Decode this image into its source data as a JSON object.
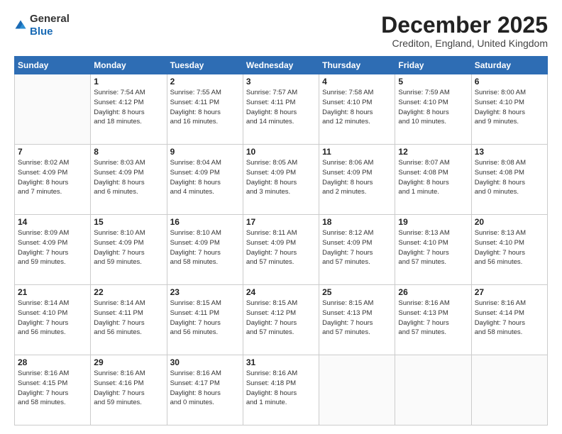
{
  "logo": {
    "general": "General",
    "blue": "Blue"
  },
  "title": "December 2025",
  "location": "Crediton, England, United Kingdom",
  "weekdays": [
    "Sunday",
    "Monday",
    "Tuesday",
    "Wednesday",
    "Thursday",
    "Friday",
    "Saturday"
  ],
  "weeks": [
    [
      {
        "day": "",
        "info": ""
      },
      {
        "day": "1",
        "info": "Sunrise: 7:54 AM\nSunset: 4:12 PM\nDaylight: 8 hours\nand 18 minutes."
      },
      {
        "day": "2",
        "info": "Sunrise: 7:55 AM\nSunset: 4:11 PM\nDaylight: 8 hours\nand 16 minutes."
      },
      {
        "day": "3",
        "info": "Sunrise: 7:57 AM\nSunset: 4:11 PM\nDaylight: 8 hours\nand 14 minutes."
      },
      {
        "day": "4",
        "info": "Sunrise: 7:58 AM\nSunset: 4:10 PM\nDaylight: 8 hours\nand 12 minutes."
      },
      {
        "day": "5",
        "info": "Sunrise: 7:59 AM\nSunset: 4:10 PM\nDaylight: 8 hours\nand 10 minutes."
      },
      {
        "day": "6",
        "info": "Sunrise: 8:00 AM\nSunset: 4:10 PM\nDaylight: 8 hours\nand 9 minutes."
      }
    ],
    [
      {
        "day": "7",
        "info": "Sunrise: 8:02 AM\nSunset: 4:09 PM\nDaylight: 8 hours\nand 7 minutes."
      },
      {
        "day": "8",
        "info": "Sunrise: 8:03 AM\nSunset: 4:09 PM\nDaylight: 8 hours\nand 6 minutes."
      },
      {
        "day": "9",
        "info": "Sunrise: 8:04 AM\nSunset: 4:09 PM\nDaylight: 8 hours\nand 4 minutes."
      },
      {
        "day": "10",
        "info": "Sunrise: 8:05 AM\nSunset: 4:09 PM\nDaylight: 8 hours\nand 3 minutes."
      },
      {
        "day": "11",
        "info": "Sunrise: 8:06 AM\nSunset: 4:09 PM\nDaylight: 8 hours\nand 2 minutes."
      },
      {
        "day": "12",
        "info": "Sunrise: 8:07 AM\nSunset: 4:08 PM\nDaylight: 8 hours\nand 1 minute."
      },
      {
        "day": "13",
        "info": "Sunrise: 8:08 AM\nSunset: 4:08 PM\nDaylight: 8 hours\nand 0 minutes."
      }
    ],
    [
      {
        "day": "14",
        "info": "Sunrise: 8:09 AM\nSunset: 4:09 PM\nDaylight: 7 hours\nand 59 minutes."
      },
      {
        "day": "15",
        "info": "Sunrise: 8:10 AM\nSunset: 4:09 PM\nDaylight: 7 hours\nand 59 minutes."
      },
      {
        "day": "16",
        "info": "Sunrise: 8:10 AM\nSunset: 4:09 PM\nDaylight: 7 hours\nand 58 minutes."
      },
      {
        "day": "17",
        "info": "Sunrise: 8:11 AM\nSunset: 4:09 PM\nDaylight: 7 hours\nand 57 minutes."
      },
      {
        "day": "18",
        "info": "Sunrise: 8:12 AM\nSunset: 4:09 PM\nDaylight: 7 hours\nand 57 minutes."
      },
      {
        "day": "19",
        "info": "Sunrise: 8:13 AM\nSunset: 4:10 PM\nDaylight: 7 hours\nand 57 minutes."
      },
      {
        "day": "20",
        "info": "Sunrise: 8:13 AM\nSunset: 4:10 PM\nDaylight: 7 hours\nand 56 minutes."
      }
    ],
    [
      {
        "day": "21",
        "info": "Sunrise: 8:14 AM\nSunset: 4:10 PM\nDaylight: 7 hours\nand 56 minutes."
      },
      {
        "day": "22",
        "info": "Sunrise: 8:14 AM\nSunset: 4:11 PM\nDaylight: 7 hours\nand 56 minutes."
      },
      {
        "day": "23",
        "info": "Sunrise: 8:15 AM\nSunset: 4:11 PM\nDaylight: 7 hours\nand 56 minutes."
      },
      {
        "day": "24",
        "info": "Sunrise: 8:15 AM\nSunset: 4:12 PM\nDaylight: 7 hours\nand 57 minutes."
      },
      {
        "day": "25",
        "info": "Sunrise: 8:15 AM\nSunset: 4:13 PM\nDaylight: 7 hours\nand 57 minutes."
      },
      {
        "day": "26",
        "info": "Sunrise: 8:16 AM\nSunset: 4:13 PM\nDaylight: 7 hours\nand 57 minutes."
      },
      {
        "day": "27",
        "info": "Sunrise: 8:16 AM\nSunset: 4:14 PM\nDaylight: 7 hours\nand 58 minutes."
      }
    ],
    [
      {
        "day": "28",
        "info": "Sunrise: 8:16 AM\nSunset: 4:15 PM\nDaylight: 7 hours\nand 58 minutes."
      },
      {
        "day": "29",
        "info": "Sunrise: 8:16 AM\nSunset: 4:16 PM\nDaylight: 7 hours\nand 59 minutes."
      },
      {
        "day": "30",
        "info": "Sunrise: 8:16 AM\nSunset: 4:17 PM\nDaylight: 8 hours\nand 0 minutes."
      },
      {
        "day": "31",
        "info": "Sunrise: 8:16 AM\nSunset: 4:18 PM\nDaylight: 8 hours\nand 1 minute."
      },
      {
        "day": "",
        "info": ""
      },
      {
        "day": "",
        "info": ""
      },
      {
        "day": "",
        "info": ""
      }
    ]
  ]
}
